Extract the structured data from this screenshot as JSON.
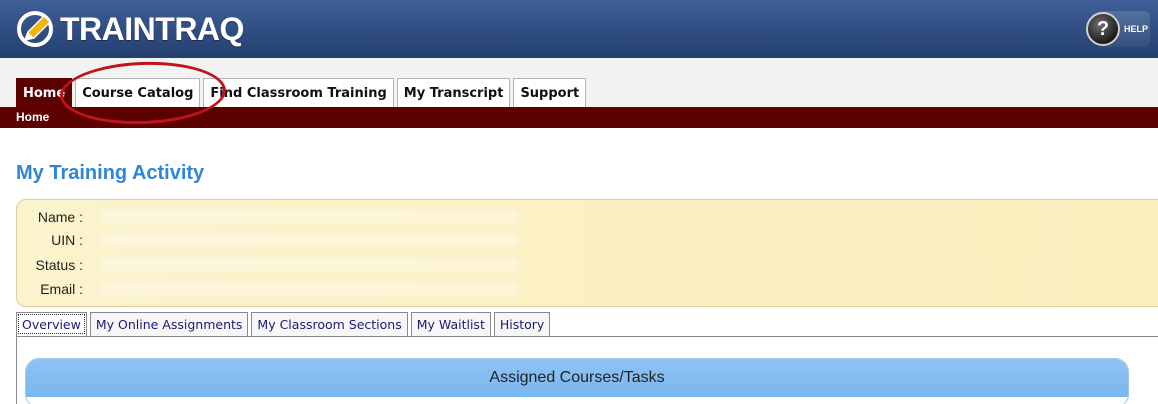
{
  "header": {
    "app_name": "TRAINTRAQ",
    "help_label": "HELP",
    "help_glyph": "?"
  },
  "nav": {
    "tabs": [
      {
        "label": "Home",
        "active": true
      },
      {
        "label": "Course Catalog",
        "active": false
      },
      {
        "label": "Find Classroom Training",
        "active": false
      },
      {
        "label": "My Transcript",
        "active": false
      },
      {
        "label": "Support",
        "active": false
      }
    ],
    "breadcrumb": "Home"
  },
  "page": {
    "title": "My Training Activity",
    "info": {
      "name_label": "Name :",
      "uin_label": "UIN :",
      "status_label": "Status :",
      "email_label": "Email :"
    },
    "subtabs": [
      {
        "label": "Overview",
        "active": true
      },
      {
        "label": "My Online Assignments",
        "active": false
      },
      {
        "label": "My Classroom Sections",
        "active": false
      },
      {
        "label": "My Waitlist",
        "active": false
      },
      {
        "label": "History",
        "active": false
      }
    ],
    "assigned_header": "Assigned Courses/Tasks"
  },
  "colors": {
    "header_blue": "#2e4b80",
    "nav_maroon": "#5c0000",
    "title_blue": "#2f86d6",
    "highlight_red": "#c0141b",
    "info_yellow": "#fbf3cc"
  },
  "icons": {
    "logo": "pencil-globe-icon",
    "help": "question-icon"
  }
}
